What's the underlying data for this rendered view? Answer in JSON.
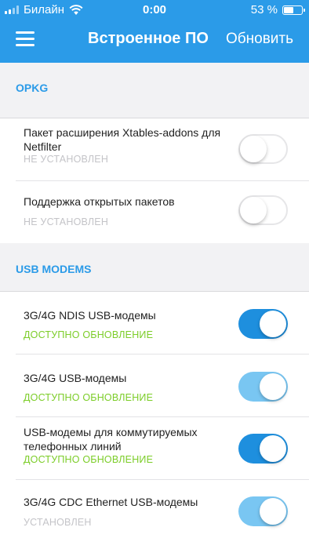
{
  "status_bar": {
    "carrier": "Билайн",
    "time": "0:00",
    "battery_percent": "53 %",
    "battery_level": 0.53
  },
  "nav": {
    "title": "Встроенное ПО",
    "action": "Обновить"
  },
  "sections": [
    {
      "title": "OPKG",
      "items": [
        {
          "title": "Пакет расширения Xtables-addons для Netfilter",
          "status": "НЕ УСТАНОВЛЕН",
          "enabled": false
        },
        {
          "title": "Поддержка открытых пакетов",
          "status": "НЕ УСТАНОВЛЕН",
          "enabled": false
        }
      ]
    },
    {
      "title": "USB MODEMS",
      "items": [
        {
          "title": "3G/4G NDIS USB-модемы",
          "status": "ДОСТУПНО ОБНОВЛЕНИЕ",
          "enabled": true
        },
        {
          "title": "3G/4G USB-модемы",
          "status": "ДОСТУПНО ОБНОВЛЕНИЕ",
          "enabled": true
        },
        {
          "title": "USB-модемы для коммутируемых телефонных линий",
          "status": "ДОСТУПНО ОБНОВЛЕНИЕ",
          "enabled": true
        },
        {
          "title": "3G/4G CDC Ethernet USB-модемы",
          "status": "УСТАНОВЛЕН",
          "enabled": true
        }
      ]
    }
  ],
  "colors": {
    "accent": "#2b9be8",
    "update_status": "#7ccd28",
    "muted_status": "#c4c4c8",
    "toggle_on": "#1e8fde",
    "toggle_on_light": "#79c6f2"
  }
}
